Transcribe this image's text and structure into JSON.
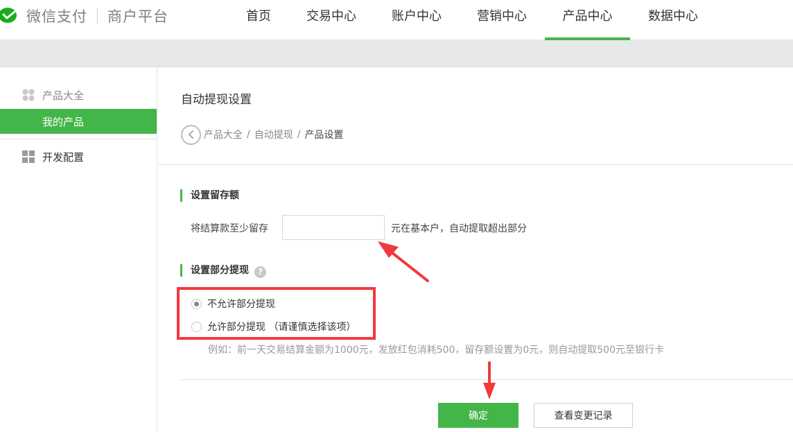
{
  "header": {
    "brand": "微信支付",
    "subtitle": "商户平台",
    "nav": [
      {
        "label": "首页",
        "active": false
      },
      {
        "label": "交易中心",
        "active": false
      },
      {
        "label": "账户中心",
        "active": false
      },
      {
        "label": "营销中心",
        "active": false
      },
      {
        "label": "产品中心",
        "active": true
      },
      {
        "label": "数据中心",
        "active": false
      }
    ]
  },
  "sidebar": {
    "items": [
      {
        "label": "产品大全",
        "icon": "product-catalog-icon"
      },
      {
        "label": "我的产品",
        "selected": true
      },
      {
        "label": "开发配置",
        "icon": "grid-icon"
      }
    ]
  },
  "page": {
    "title": "自动提现设置",
    "breadcrumb": [
      "产品大全",
      "自动提现",
      "产品设置"
    ]
  },
  "retain": {
    "section_title": "设置留存额",
    "label": "将结算款至少留存",
    "input_value": "",
    "suffix": "元在基本户，自动提取超出部分"
  },
  "partial": {
    "section_title": "设置部分提现",
    "help": "?",
    "options": [
      {
        "label": "不允许部分提现",
        "checked": true
      },
      {
        "label": "允许部分提现 （请谨慎选择该项）",
        "checked": false
      }
    ],
    "example": "例如：前一天交易结算金额为1000元，发放红包消耗500，留存额设置为0元，则自动提取500元至银行卡"
  },
  "actions": {
    "confirm": "确定",
    "history": "查看变更记录"
  },
  "colors": {
    "accent": "#44b549",
    "annotation": "#f03a3e"
  }
}
